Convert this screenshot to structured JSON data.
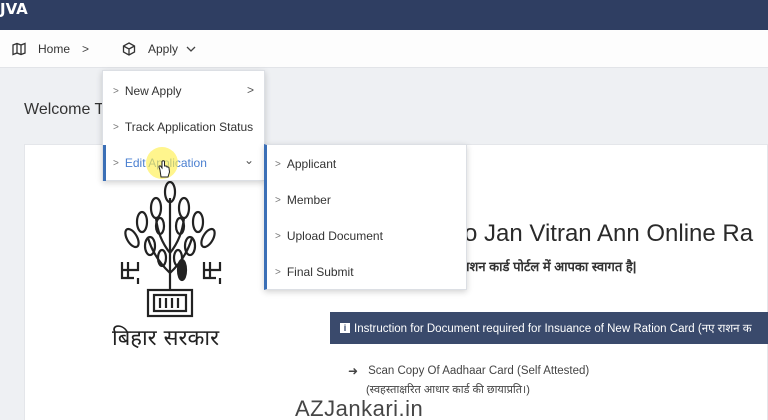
{
  "brand": "JVA",
  "breadcrumb": {
    "home_label": "Home",
    "apply_label": "Apply",
    "separator": ">"
  },
  "welcome": "Welcome T",
  "apply_menu": {
    "items": [
      {
        "label": "New Apply",
        "bullet": ">",
        "submenu_arrow": ">"
      },
      {
        "label": "Track Application Status",
        "bullet": ">"
      },
      {
        "label": "Edit Application",
        "bullet": ">",
        "submenu_arrow": "⌄"
      }
    ]
  },
  "edit_submenu": {
    "items": [
      {
        "label": "Applicant",
        "bullet": ">"
      },
      {
        "label": "Member",
        "bullet": ">"
      },
      {
        "label": "Upload Document",
        "bullet": ">"
      },
      {
        "label": "Final Submit",
        "bullet": ">"
      }
    ]
  },
  "hero": {
    "title": "o Jan Vitran Ann Online Ra",
    "subtitle": "न राशन कार्ड पोर्टल में आपका स्वागत है|"
  },
  "government_text": "बिहार सरकार",
  "instruction_bar": {
    "icon": "i",
    "text": "Instruction for Document required for Insuance of New Ration Card (नए राशन क"
  },
  "documents": [
    {
      "label": "Scan Copy Of Aadhaar Card (Self Attested)",
      "label_hindi": "(स्वहस्ताक्षरित आधार कार्ड की छायाप्रति।)"
    }
  ],
  "watermark": "AZJankari.in",
  "colors": {
    "topbar": "#2f3e62",
    "accent": "#3b6fb6",
    "instruction_bar": "#3a4a6c"
  }
}
